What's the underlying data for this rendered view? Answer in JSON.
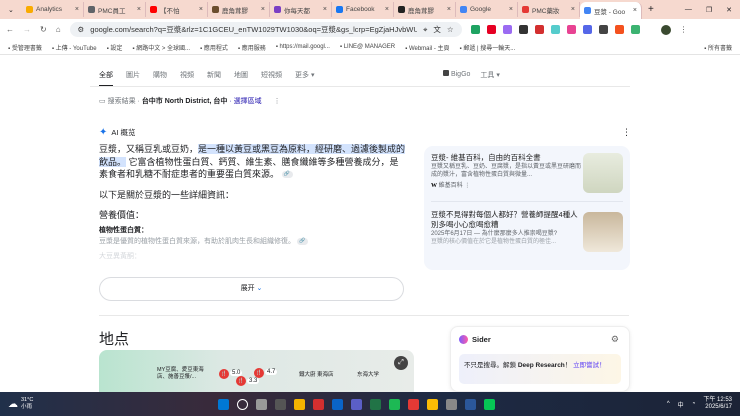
{
  "browser": {
    "tabs": [
      {
        "title": "Analytics",
        "color": "#f9ab00"
      },
      {
        "title": "PMC員工",
        "color": "#5f6368"
      },
      {
        "title": "【不怕",
        "color": "#ff0000"
      },
      {
        "title": "鹿角茸膠",
        "color": "#6b4e2e"
      },
      {
        "title": "你每天都",
        "color": "#7b3fc4"
      },
      {
        "title": "Facebook",
        "color": "#1877f2"
      },
      {
        "title": "鹿角茸膠",
        "color": "#222"
      },
      {
        "title": "Google",
        "color": "#4285f4"
      },
      {
        "title": "PMC藥妝",
        "color": "#e53935"
      },
      {
        "title": "豆漿 - Goo",
        "color": "#4285f4",
        "active": true
      }
    ],
    "url": "google.com/search?q=豆漿&rlz=1C1GCEU_enTW1029TW1030&oq=豆漿&gs_lcrp=EgZjaHJvbWUq...",
    "bookmarks": [
      "受管理書籤",
      "上傳 - YouTube",
      "設定",
      "網路中文 > 全球國...",
      "應用程式",
      "應用服務",
      "https://mail.googl...",
      "LINE@ MANAGER",
      "Webmail - 主頁",
      "郵遞 | 搜尋一輪天...",
      "所有書籤"
    ]
  },
  "search": {
    "tabs": [
      "全部",
      "圖片",
      "購物",
      "視頻",
      "新聞",
      "地圖",
      "短視頻",
      "更多"
    ],
    "bigo": "BigGo",
    "tools": "工具",
    "location": {
      "prefix": "搜索結果 ·",
      "place": "台中市 North District, 台中",
      "change": "· 選擇區域"
    },
    "ai_title": "AI 概览",
    "ai_intro_plain": "豆漿，又稱豆乳或豆奶，",
    "ai_intro_highlight": "是一種以黃豆或黑豆為原料，經研磨、過濾後製成的飲品。",
    "ai_intro_rest": "它富含植物性蛋白質、鈣質、維生素、膳食纖維等多種營養成分，是素食者和乳糖不耐症患者的重要蛋白質來源。",
    "ai_details": "以下是關於豆漿的一些詳細資訊：",
    "nutrition": "營養價值：",
    "protein_title": "植物性蛋白質：",
    "protein_text": "豆漿是優質的植物性蛋白質來源，有助於肌肉生長和組織修復。",
    "faded": "大豆異黃酮：",
    "expand": "展开",
    "cards": [
      {
        "title": "豆漿- 維基百科，自由的百科全書",
        "snippet": "豆漿又稱豆乳、豆奶、豆腐漿，是指以黃豆或黑豆研磨而成的漿汁，富含植物性蛋白質與微量...",
        "source": "維基百科"
      },
      {
        "title": "豆漿不見得對每個人都好？營養師提醒4種人別多喝小心愈喝愈糟",
        "date": "2025年6月17日 — 為什麼那麼多人推崇喝豆漿?",
        "snippet": "豆漿的核心價值在於它是植物性蛋白質的極佳..."
      }
    ],
    "places_title": "地点",
    "map": {
      "labels": [
        "MY豆腐、愛豆東海店、施善豆漿/...",
        "鐵大廚 東海店",
        "东海大学"
      ],
      "ratings": [
        "5.0",
        "3.3",
        "4.7"
      ]
    },
    "sider": {
      "title": "Sider",
      "text": "不只是搜尋。解鎖 ",
      "bold": "Deep Research",
      "excl": "！",
      "cta": "立即嘗試！"
    }
  },
  "taskbar": {
    "temp": "31°C",
    "weather": "小雨",
    "time": "下午 12:53",
    "date": "2025/6/17",
    "ime": "中"
  }
}
